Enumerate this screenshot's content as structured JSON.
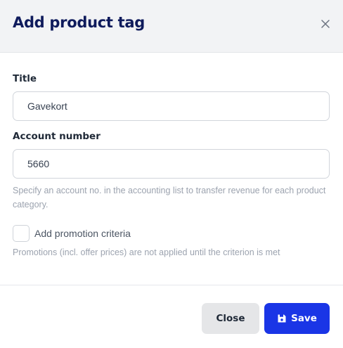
{
  "dialog": {
    "title": "Add product tag",
    "close_icon": "close-icon"
  },
  "form": {
    "title_label": "Title",
    "title_value": "Gavekort",
    "account_label": "Account number",
    "account_value": "5660",
    "account_help": "Specify an account no. in the accounting list to transfer revenue for each product category.",
    "promotion_label": "Add promotion criteria",
    "promotion_checked": false,
    "promotion_help": "Promotions (incl. offer prices) are not applied until the criterion is met"
  },
  "footer": {
    "close_label": "Close",
    "save_label": "Save",
    "save_icon": "floppy-disk-icon"
  },
  "colors": {
    "primary": "#1a35e6",
    "title": "#0f1b5c",
    "header_bg": "#f2f3f5",
    "muted_text": "#9ca3af"
  }
}
